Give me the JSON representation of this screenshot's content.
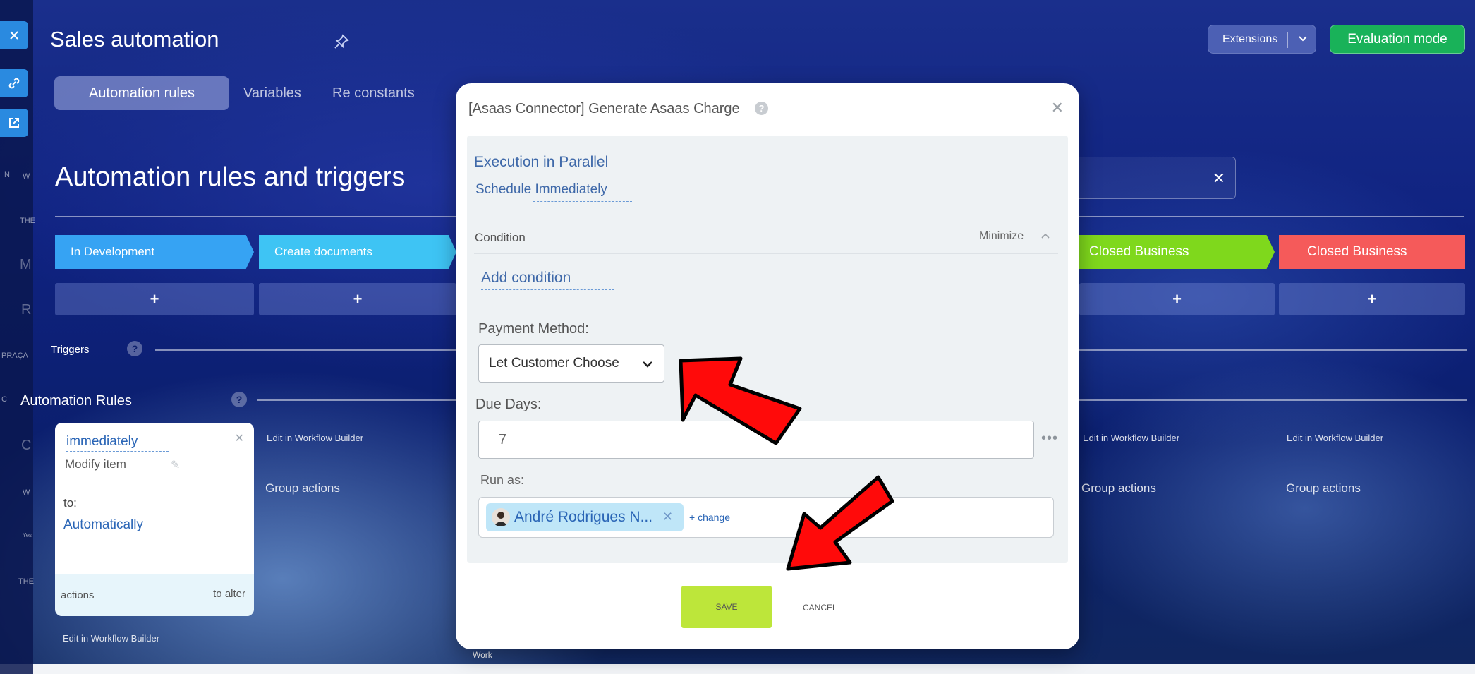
{
  "app": {
    "title": "Sales automation",
    "tabs": [
      {
        "label": "Automation rules"
      },
      {
        "label": "Variables"
      },
      {
        "label": "Re constants"
      }
    ],
    "extensions_label": "Extensions",
    "evaluation_label": "Evaluation mode"
  },
  "rail": {
    "labels": [
      "N",
      "W",
      "THE",
      "M",
      "R",
      "PRAÇA",
      "C",
      "C",
      "W",
      "Yes",
      "THE"
    ]
  },
  "main": {
    "section_title": "Automation rules and triggers",
    "stages": [
      {
        "label": "In Development",
        "color": "#36a3f3"
      },
      {
        "label": "Create documents",
        "color": "#3ec4f4"
      },
      {
        "label": "Closed Business",
        "color": "#7fd81c"
      },
      {
        "label": "Closed Business",
        "color": "#f55a5a"
      }
    ],
    "add_symbol": "+",
    "triggers_label": "Triggers",
    "rules_label": "Automation Rules",
    "help_symbol": "?",
    "rule_card": {
      "schedule": "immediately",
      "action": "Modify item",
      "to_label": "to:",
      "value": "Automatically",
      "footer_left": "actions",
      "footer_right": "to alter"
    },
    "edit_workflow_label": "Edit in Workflow Builder",
    "group_actions_label": "Group actions",
    "work_label": "Work"
  },
  "modal": {
    "title": "[Asaas Connector] Generate Asaas Charge",
    "execution": "Execution in Parallel",
    "schedule": "Schedule Immediately",
    "condition_label": "Condition",
    "minimize_label": "Minimize",
    "add_condition": "Add condition",
    "payment_label": "Payment Method:",
    "payment_value": "Let Customer Choose",
    "due_label": "Due Days:",
    "due_value": "7",
    "more_symbol": "•••",
    "runas_label": "Run as:",
    "user_name": "André Rodrigues N...",
    "change_label": "+ change",
    "save_label": "SAVE",
    "cancel_label": "CANCEL"
  },
  "colors": {
    "accent_green": "#19b259",
    "save_green": "#bde63a",
    "link_blue": "#2a65b6",
    "arrow_red": "#ff0a0a"
  }
}
